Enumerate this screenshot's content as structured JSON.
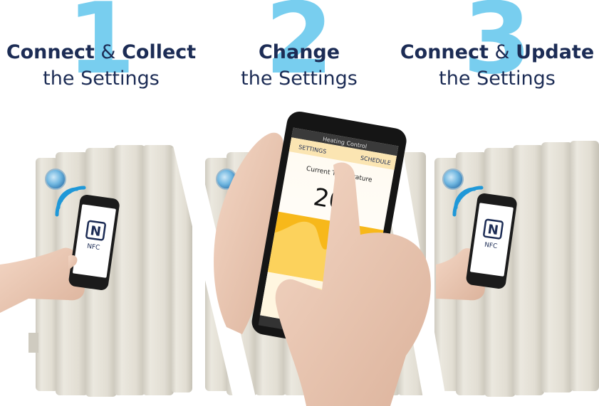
{
  "steps": [
    {
      "number": "1",
      "bold_a": "Connect",
      "amp": " & ",
      "bold_b": "Collect",
      "line2": "the Settings"
    },
    {
      "number": "2",
      "bold_a": "Change",
      "amp": "",
      "bold_b": "",
      "line2": "the Settings"
    },
    {
      "number": "3",
      "bold_a": "Connect",
      "amp": " & ",
      "bold_b": "Update",
      "line2": "the Settings"
    }
  ],
  "phone_app": {
    "title": "Heating Control",
    "tab_settings": "SETTINGS",
    "tab_schedule": "SCHEDULE",
    "temp_label": "Current Temperature",
    "temp_value": "20"
  },
  "nfc_label": "NFC",
  "colors": {
    "number_blue": "#5bc4ec",
    "heading_navy": "#1c2c55",
    "radiator": "#e2ded3",
    "accent_yellow": "#f7b81a",
    "wifi_blue": "#1f98d8"
  }
}
